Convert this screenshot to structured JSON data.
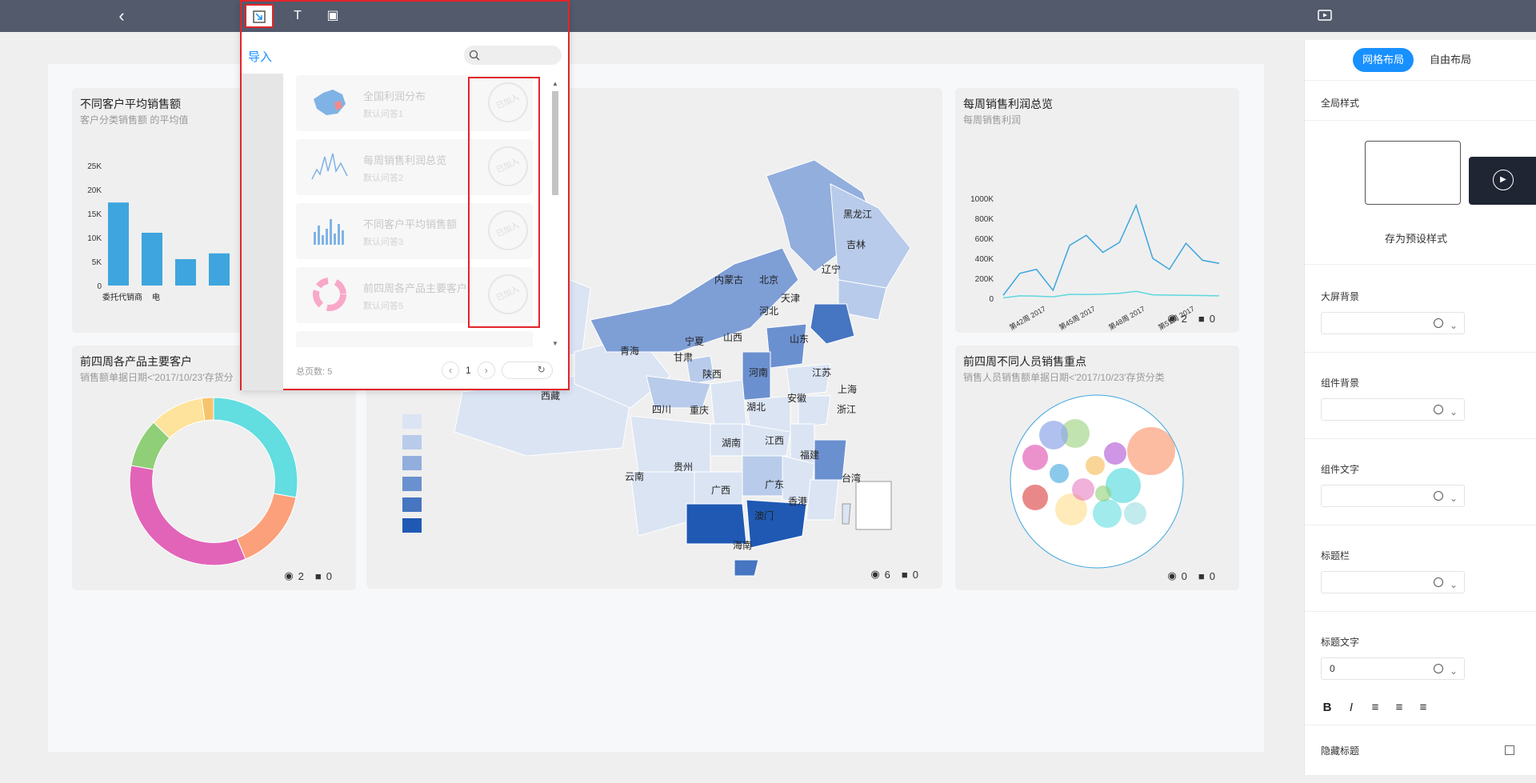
{
  "topbar": {
    "back_icon": "chevron-left-icon",
    "preview_icon": "play-screen-icon"
  },
  "cards": {
    "avg_sales": {
      "title": "不同客户平均销售额",
      "subtitle": "客户分类销售额 的平均值"
    },
    "weekly_profit": {
      "title": "每周销售利润总览",
      "subtitle": "每周销售利润",
      "views": "2",
      "comments": "0"
    },
    "top_customers": {
      "title": "前四周各产品主要客户",
      "subtitle": "销售额单据日期<'2017/10/23'存货分",
      "views": "2",
      "comments": "0"
    },
    "map": {
      "views": "6",
      "comments": "0"
    },
    "sales_focus": {
      "title": "前四周不同人员销售重点",
      "subtitle": "销售人员销售额单据日期<'2017/10/23'存货分类",
      "views": "0",
      "comments": "0"
    }
  },
  "chart_data": [
    {
      "type": "bar",
      "title": "不同客户平均销售额",
      "categories": [
        "委托代销商",
        "电",
        "",
        ""
      ],
      "values": [
        17300,
        11000,
        5500,
        6700
      ],
      "ylim": [
        0,
        25000
      ],
      "yticks": [
        "0",
        "5K",
        "10K",
        "15K",
        "20K",
        "25K"
      ],
      "color": "#3ea5de"
    },
    {
      "type": "line",
      "title": "每周销售利润总览",
      "x": [
        "第42周 2017",
        "",
        "",
        "第45周 2017",
        "",
        "",
        "第48周 2017",
        "",
        "",
        "第51周 2017",
        "",
        "",
        ""
      ],
      "yticks": [
        "0",
        "200K",
        "400K",
        "600K",
        "800K",
        "1000K"
      ],
      "ylim": [
        0,
        1000000
      ],
      "xtick_labels": [
        "第42周 2017",
        "第45周 2017",
        "第48周 2017",
        "第51周 2017"
      ],
      "series": [
        {
          "color": "#3ea5de",
          "values": [
            30000,
            250000,
            290000,
            80000,
            530000,
            630000,
            460000,
            560000,
            930000,
            400000,
            290000,
            550000,
            380000,
            350000
          ]
        },
        {
          "color": "#5fd7dd",
          "values": [
            5000,
            25000,
            22000,
            15000,
            40000,
            38000,
            42000,
            50000,
            70000,
            35000,
            32000,
            30000,
            28000,
            25000
          ]
        }
      ]
    }
  ],
  "map": {
    "provinces": [
      "黑龙江",
      "吉林",
      "辽宁",
      "内蒙古",
      "北京",
      "天津",
      "河北",
      "山西",
      "宁夏",
      "青海",
      "甘肃",
      "山东",
      "陕西",
      "河南",
      "江苏",
      "上海",
      "西藏",
      "四川",
      "重庆",
      "湖北",
      "安徽",
      "浙江",
      "湖南",
      "江西",
      "贵州",
      "福建",
      "台湾",
      "云南",
      "广西",
      "广东",
      "香港",
      "澳门",
      "海南"
    ],
    "legend_colors": [
      "#dbe4f3",
      "#b8cbea",
      "#92aedd",
      "#6b90cf",
      "#4675c1",
      "#1f59b3"
    ]
  },
  "right_panel": {
    "mode_grid": "网格布局",
    "mode_free": "自由布局",
    "global_style": "全局样式",
    "save_preset": "存为预设样式",
    "screen_bg": "大屏背景",
    "widget_bg": "组件背景",
    "widget_text": "组件文字",
    "title_bar": "标题栏",
    "title_text": "标题文字",
    "title_text_value": "0",
    "hide_title": "隐藏标题",
    "format_icons": [
      "bold-icon",
      "italic-icon",
      "align-left-icon",
      "align-center-icon",
      "align-right-icon"
    ]
  },
  "import_panel": {
    "heading": "导入",
    "search_placeholder": "",
    "tools": [
      "import-icon",
      "text-icon",
      "image-icon"
    ],
    "items": [
      {
        "name": "全国利润分布",
        "answer": "默认问答1",
        "stamp": "已加入"
      },
      {
        "name": "每周销售利润总览",
        "answer": "默认问答2",
        "stamp": "已加入"
      },
      {
        "name": "不同客户平均销售额",
        "answer": "默认问答3",
        "stamp": "已加入"
      },
      {
        "name": "前四周各产品主要客户",
        "answer": "默认问答5",
        "stamp": "已加入"
      }
    ],
    "total_label": "总页数: 5",
    "page": "1"
  }
}
